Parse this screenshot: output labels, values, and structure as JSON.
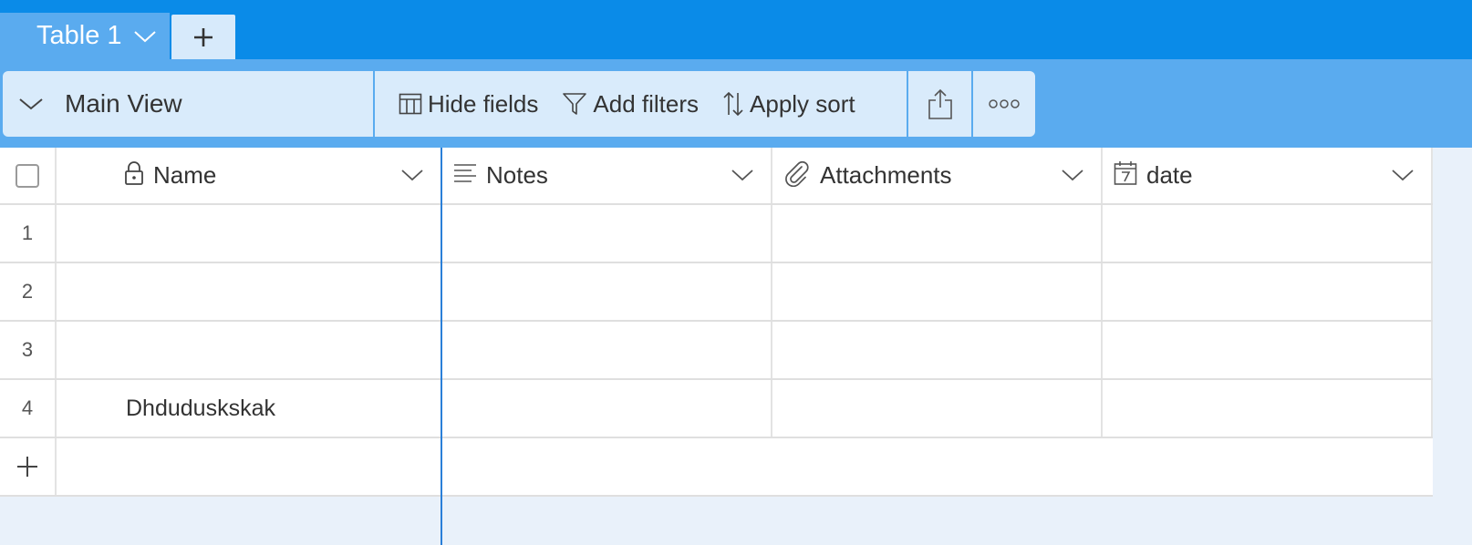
{
  "tabs": {
    "active_label": "Table 1",
    "add_label": "+"
  },
  "toolbar": {
    "view_label": "Main View",
    "hide_fields": "Hide fields",
    "add_filters": "Add filters",
    "apply_sort": "Apply sort"
  },
  "grid": {
    "columns": [
      {
        "label": "Name",
        "icon": "lock-icon"
      },
      {
        "label": "Notes",
        "icon": "text-lines-icon"
      },
      {
        "label": "Attachments",
        "icon": "paperclip-icon"
      },
      {
        "label": "date",
        "icon": "calendar-icon"
      }
    ],
    "rows": [
      {
        "num": "1",
        "name": ""
      },
      {
        "num": "2",
        "name": ""
      },
      {
        "num": "3",
        "name": ""
      },
      {
        "num": "4",
        "name": "Dhduduskskak"
      }
    ],
    "add_row_label": "+"
  },
  "colors": {
    "tabbar": "#0a8be8",
    "toolband": "#5aabef",
    "toolbutton": "#d9ebfb",
    "freeze_line": "#2a7fd8",
    "background": "#e9f1fa"
  }
}
